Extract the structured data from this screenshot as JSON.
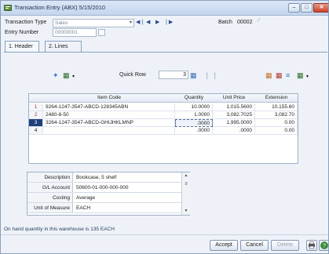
{
  "window": {
    "title": "Transaction Entry (ABX) 5/15/2010"
  },
  "header_form": {
    "transaction_type_label": "Transaction Type",
    "transaction_type_value": "Sales",
    "entry_number_label": "Entry Number",
    "entry_number_value": "00000001",
    "batch_label": "Batch",
    "batch_value": "00002"
  },
  "tabs": [
    {
      "label": "1. Header",
      "active": false
    },
    {
      "label": "2. Lines",
      "active": true
    }
  ],
  "toolbar": {
    "quick_row_label": "Quick Row",
    "quick_row_value": "3"
  },
  "grid": {
    "columns": [
      "Item Code",
      "Quantity",
      "Unit Price",
      "Extension"
    ],
    "rows": [
      {
        "num": "1",
        "item_code": "9264-1247-3547-ABCD-128345ABN",
        "quantity": "10.0000",
        "unit_price": "1,015.5600",
        "extension": "10,155.60"
      },
      {
        "num": "2",
        "item_code": "2480-8-50",
        "quantity": "1.0000",
        "unit_price": "3,082.7025",
        "extension": "3,082.70"
      },
      {
        "num": "3",
        "item_code": "3264-1247-3547-ABCD-GHIJHKLMNP",
        "quantity": ".0000",
        "unit_price": "1,995.0000",
        "extension": "0.00"
      },
      {
        "num": "4",
        "item_code": "",
        "quantity": ".0000",
        "unit_price": ".0000",
        "extension": "0.00"
      }
    ]
  },
  "properties": [
    {
      "label": "Description",
      "value": "Bookcase, 5 shelf"
    },
    {
      "label": "G/L Account",
      "value": "50600-01-000-000-000"
    },
    {
      "label": "Costing",
      "value": "Average"
    },
    {
      "label": "Unit of Measure",
      "value": "EACH"
    }
  ],
  "status": {
    "message": "On hand quantity in this warehouse is 135 EACH"
  },
  "buttons": {
    "accept": "Accept",
    "cancel": "Cancel",
    "delete": "Delete"
  },
  "colors": {
    "selected_row": "#1f3f7a",
    "row_number_text": "#b4332b",
    "title_bar": "#c3d5ee"
  }
}
